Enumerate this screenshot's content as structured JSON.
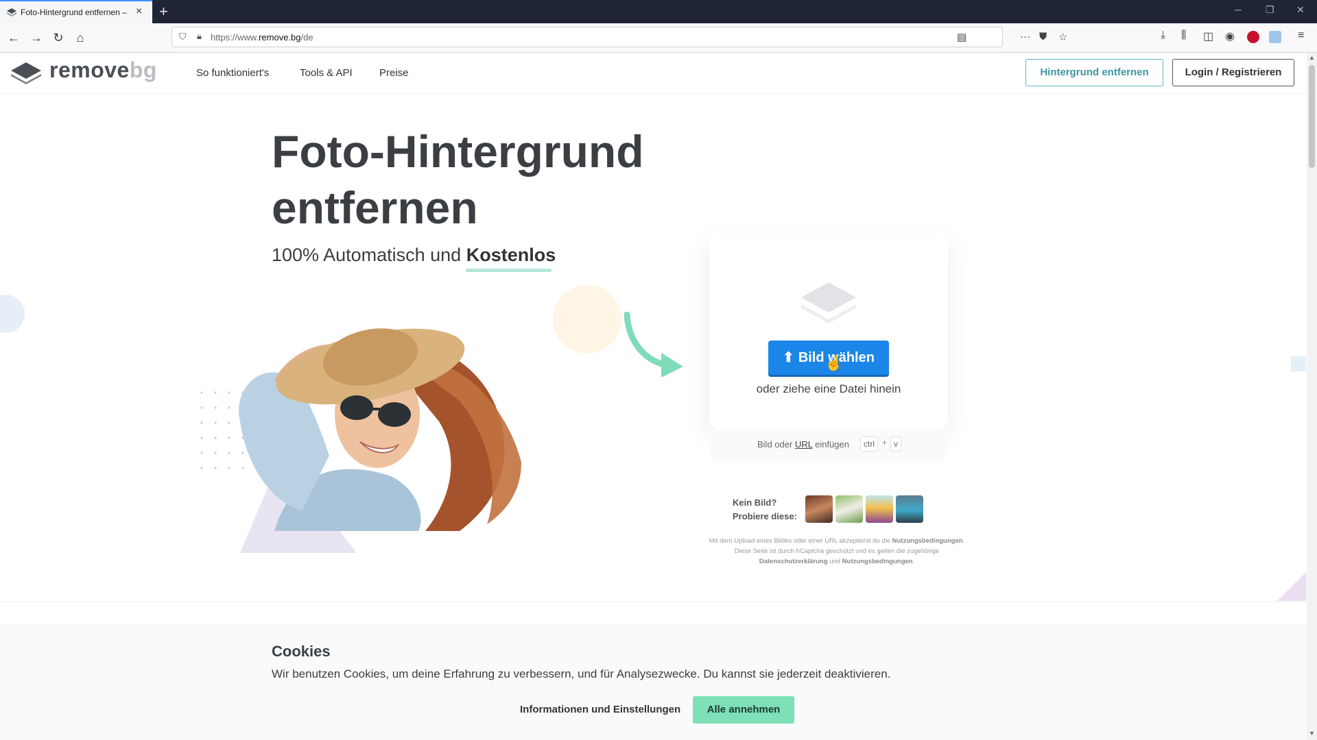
{
  "browser": {
    "tab_title": "Foto-Hintergrund entfernen –",
    "url_prefix": "https://www.",
    "url_domain": "remove.bg",
    "url_suffix": "/de",
    "new_tab_label": "+",
    "close_tab_label": "×"
  },
  "header": {
    "logo_main": "remove",
    "logo_accent": "bg",
    "nav": [
      "So funktioniert's",
      "Tools & API",
      "Preise"
    ],
    "cta_primary": "Hintergrund entfernen",
    "cta_login": "Login / Registrieren"
  },
  "hero": {
    "title": "Foto-Hintergrund entfernen",
    "subtitle_prefix": "100% Automatisch und",
    "subtitle_highlight": "Kostenlos"
  },
  "upload": {
    "button_label": "Bild wählen",
    "drop_text": "oder ziehe eine Datei hinein",
    "paste_prefix": "Bild oder",
    "paste_url": "URL",
    "paste_suffix": "einfügen",
    "kbd_ctrl": "ctrl",
    "kbd_plus": "+",
    "kbd_v": "v"
  },
  "samples": {
    "label_line1": "Kein Bild?",
    "label_line2": "Probiere diese:"
  },
  "legal": {
    "text1": "Mit dem Upload eines Bildes oder einer URL akzeptierst du die",
    "link1": "Nutzungsbedingungen",
    "text2": ". Diese Seite ist durch hCaptcha geschützt und es gelten die zugehörige",
    "link2": "Datenschutzerklärung",
    "text3": "und",
    "link3": "Nutzungsbedingungen",
    "text4": "."
  },
  "cookie": {
    "title": "Cookies",
    "text": "Wir benutzen Cookies, um deine Erfahrung zu verbessern, und für Analysezwecke. Du kannst sie jederzeit deaktivieren.",
    "info_button": "Informationen und Einstellungen",
    "accept_button": "Alle annehmen"
  },
  "colors": {
    "upload_blue": "#1b86e8",
    "accent_teal": "#57b7bf",
    "accept_green": "#7de0b6",
    "tabbar": "#1f2437"
  }
}
